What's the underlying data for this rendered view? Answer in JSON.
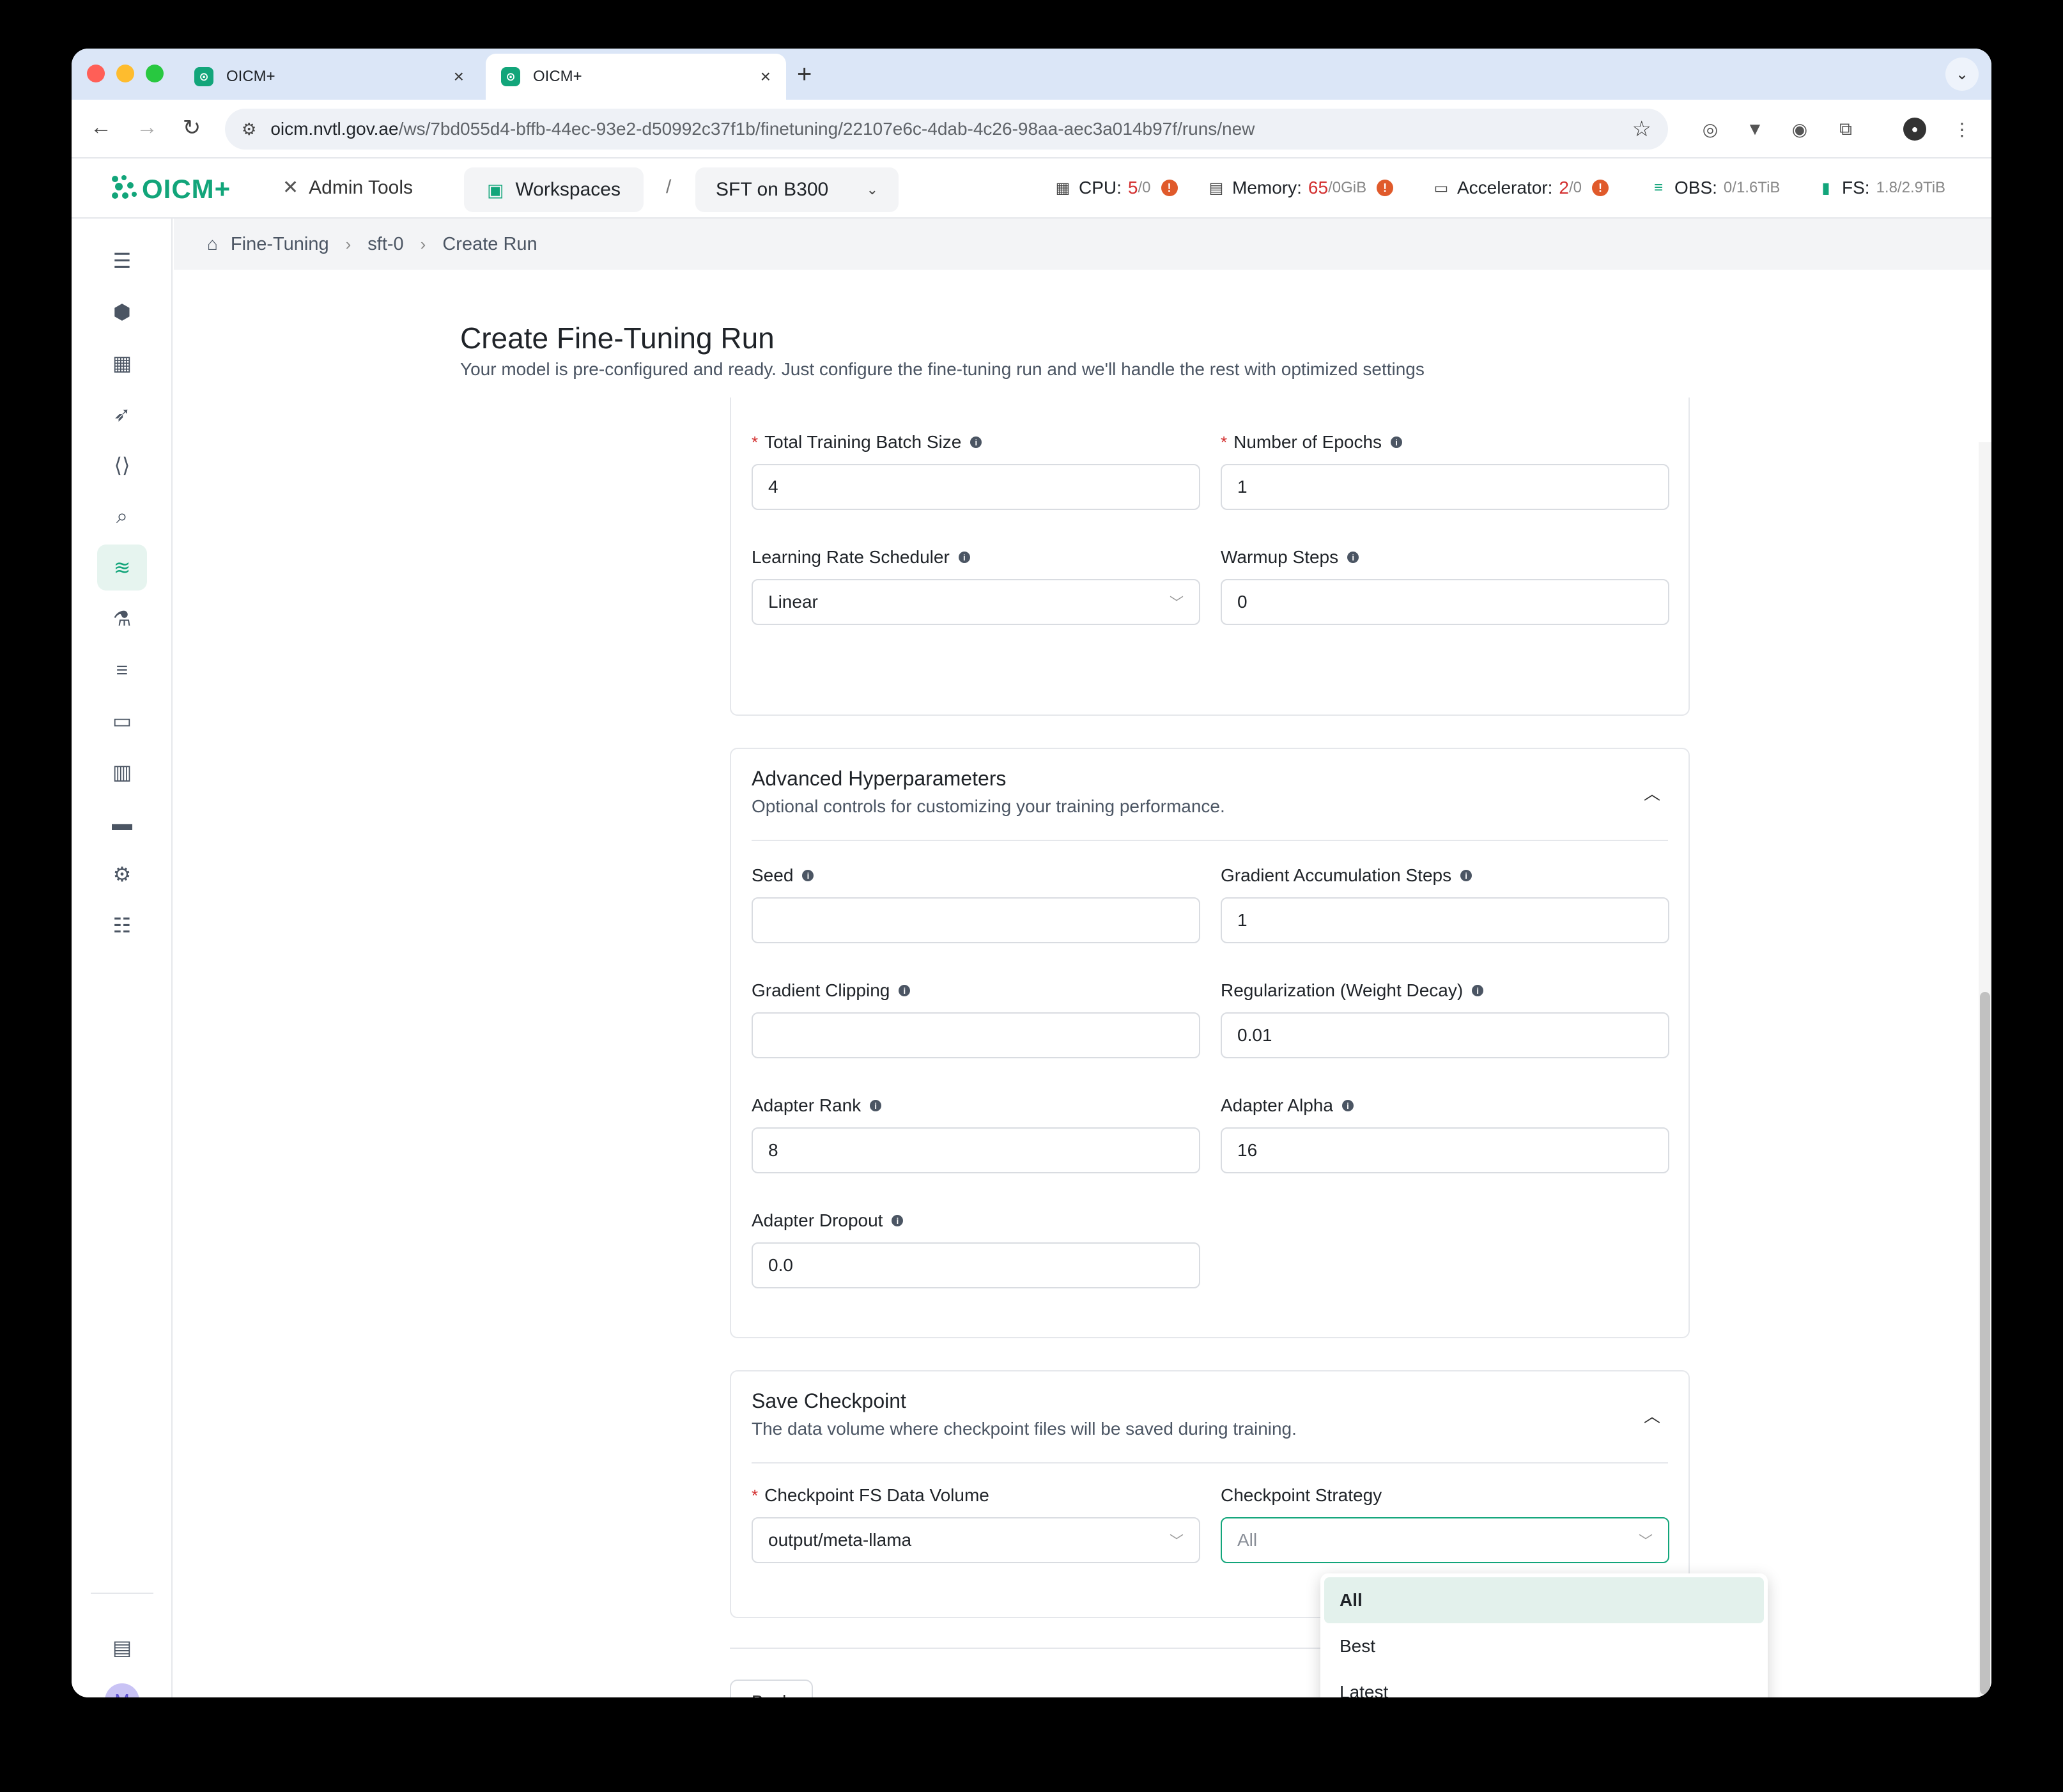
{
  "browser": {
    "tabs": [
      {
        "title": "OICM+",
        "active": false
      },
      {
        "title": "OICM+",
        "active": true
      }
    ],
    "url_host": "oicm.nvtl.gov.ae",
    "url_path": "/ws/7bd055d4-bffb-44ec-93e2-d50992c37f1b/finetuning/22107e6c-4dab-4c26-98aa-aec3a014b97f/runs/new"
  },
  "header": {
    "logo_text": "OICM+",
    "admin_tools": "Admin Tools",
    "workspaces": "Workspaces",
    "separator": "/",
    "workspace_name": "SFT on B300",
    "quotas": [
      {
        "label": "CPU:",
        "used": "5",
        "total": "/0",
        "icon": "cpu-icon"
      },
      {
        "label": "Memory:",
        "used": "65",
        "total": "/0GiB",
        "icon": "memory-icon"
      },
      {
        "label": "Accelerator:",
        "used": "2",
        "total": "/0",
        "icon": "gpu-icon"
      },
      {
        "label": "OBS:",
        "used": "0/1.6TiB",
        "total": "",
        "icon": "database-icon"
      },
      {
        "label": "FS:",
        "used": "1.8/2.9TiB",
        "total": "",
        "icon": "file-icon"
      }
    ]
  },
  "breadcrumb": [
    "Fine-Tuning",
    "sft-0",
    "Create Run"
  ],
  "page": {
    "title": "Create Fine-Tuning Run",
    "subtitle": "Your model is pre-configured and ready. Just configure the fine-tuning run and we'll handle the rest with optimized settings"
  },
  "basic": {
    "batch_size_label": "Total Training Batch Size",
    "batch_size_value": "4",
    "epochs_label": "Number of Epochs",
    "epochs_value": "1",
    "scheduler_label": "Learning Rate Scheduler",
    "scheduler_value": "Linear",
    "warmup_label": "Warmup Steps",
    "warmup_value": "0"
  },
  "advanced": {
    "title": "Advanced Hyperparameters",
    "subtitle": "Optional controls for customizing your training performance.",
    "seed_label": "Seed",
    "seed_value": "",
    "grad_accum_label": "Gradient Accumulation Steps",
    "grad_accum_value": "1",
    "grad_clip_label": "Gradient Clipping",
    "grad_clip_value": "",
    "weight_decay_label": "Regularization (Weight Decay)",
    "weight_decay_value": "0.01",
    "adapter_rank_label": "Adapter Rank",
    "adapter_rank_value": "8",
    "adapter_alpha_label": "Adapter Alpha",
    "adapter_alpha_value": "16",
    "adapter_dropout_label": "Adapter Dropout",
    "adapter_dropout_value": "0.0"
  },
  "checkpoint": {
    "title": "Save Checkpoint",
    "subtitle": "The data volume where checkpoint files will be saved during training.",
    "volume_label": "Checkpoint FS Data Volume",
    "volume_value": "output/meta-llama",
    "strategy_label": "Checkpoint Strategy",
    "strategy_placeholder": "All",
    "strategy_options": [
      "All",
      "Best",
      "Latest"
    ],
    "strategy_selected": "All"
  },
  "footer": {
    "back_label": "Back"
  },
  "colors": {
    "accent": "#12a57a",
    "required": "#d32f2f",
    "warning": "#e05a2b"
  }
}
